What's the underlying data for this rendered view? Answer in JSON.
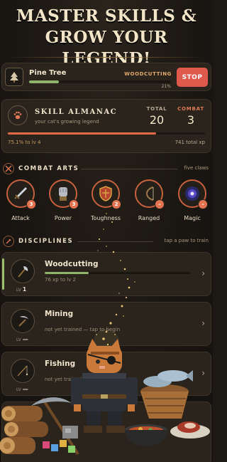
{
  "banner": {
    "line1": "MASTER SKILLS &",
    "line2": "GROW YOUR LEGEND!"
  },
  "activity": {
    "icon": "tree-icon",
    "name": "Pine Tree",
    "skill": "WOODCUTTING",
    "progress": 0.21,
    "percent_label": "21%",
    "stop_label": "STOP",
    "stop_color": "#e0594d"
  },
  "almanac": {
    "icon": "paw-icon",
    "title": "SKILL ALMANAC",
    "subtitle": "your cat's growing legend",
    "total_label": "TOTAL",
    "total_value": "20",
    "combat_label": "COMBAT",
    "combat_value": "3",
    "progress": 0.751,
    "progress_label": "75.1% to lv 4",
    "xp_label": "741 total xp"
  },
  "combat_arts": {
    "title": "COMBAT ARTS",
    "right_label": "five claws",
    "items": [
      {
        "name": "Attack",
        "icon": "sword-icon",
        "badge": "3"
      },
      {
        "name": "Power",
        "icon": "gauntlet-icon",
        "badge": "3"
      },
      {
        "name": "Toughness",
        "icon": "shield-icon",
        "badge": "2"
      },
      {
        "name": "Ranged",
        "icon": "bow-icon",
        "badge": "–"
      },
      {
        "name": "Magic",
        "icon": "vortex-icon",
        "badge": "–"
      }
    ]
  },
  "disciplines": {
    "title": "DISCIPLINES",
    "right_label": "tap a paw to train",
    "items": [
      {
        "name": "Woodcutting",
        "icon": "axe-icon",
        "lv_prefix": "LV",
        "lv_value": "1",
        "subtitle": "76 xp to lv 2",
        "progress": 0.3,
        "active": true
      },
      {
        "name": "Mining",
        "icon": "pickaxe-icon",
        "lv_prefix": "LV",
        "lv_value": "—",
        "subtitle": "not yet trained — tap to begin",
        "progress": 0,
        "active": false
      },
      {
        "name": "Fishing",
        "icon": "fishing-rod-icon",
        "lv_prefix": "LV",
        "lv_value": "—",
        "subtitle": "not yet trained",
        "progress": 0,
        "active": false
      }
    ]
  },
  "colors": {
    "accent": "#e0694a",
    "green": "#8fb36a",
    "gold": "#e2a96a"
  }
}
